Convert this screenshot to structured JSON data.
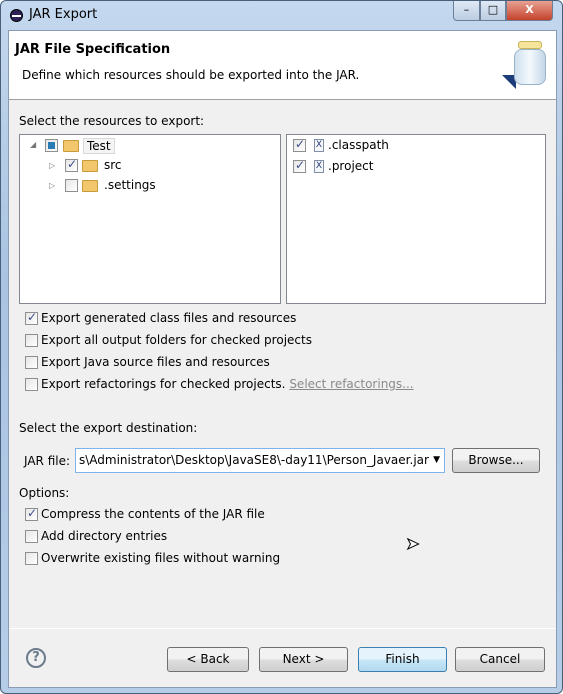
{
  "window": {
    "title": "JAR Export",
    "min": "–",
    "max": "□",
    "close": "X"
  },
  "header": {
    "title": "JAR File Specification",
    "description": "Define which resources should be exported into the JAR."
  },
  "resources": {
    "label": "Select the resources to export:",
    "tree": [
      {
        "label": "Test",
        "state": "partial",
        "expanded": true
      },
      {
        "label": "src",
        "state": "checked"
      },
      {
        "label": ".settings",
        "state": "unchecked"
      }
    ],
    "files": [
      {
        "label": ".classpath",
        "checked": true,
        "icon": "X"
      },
      {
        "label": ".project",
        "checked": true,
        "icon": "X"
      }
    ]
  },
  "export_options": [
    {
      "label": "Export generated class files and resources",
      "checked": true
    },
    {
      "label": "Export all output folders for checked projects",
      "checked": false
    },
    {
      "label": "Export Java source files and resources",
      "checked": false
    },
    {
      "label": "Export refactorings for checked projects.",
      "checked": false,
      "link": "Select refactorings..."
    }
  ],
  "destination": {
    "label": "Select the export destination:",
    "jar_label": "JAR file:",
    "jar_value": "s\\Administrator\\Desktop\\JavaSE8\\-day11\\Person_Javaer.jar",
    "browse": "Browse..."
  },
  "options": {
    "label": "Options:",
    "items": [
      {
        "label": "Compress the contents of the JAR file",
        "checked": true
      },
      {
        "label": "Add directory entries",
        "checked": false
      },
      {
        "label": "Overwrite existing files without warning",
        "checked": false
      }
    ]
  },
  "footer": {
    "help": "?",
    "back": "< Back",
    "next": "Next >",
    "finish": "Finish",
    "cancel": "Cancel"
  }
}
